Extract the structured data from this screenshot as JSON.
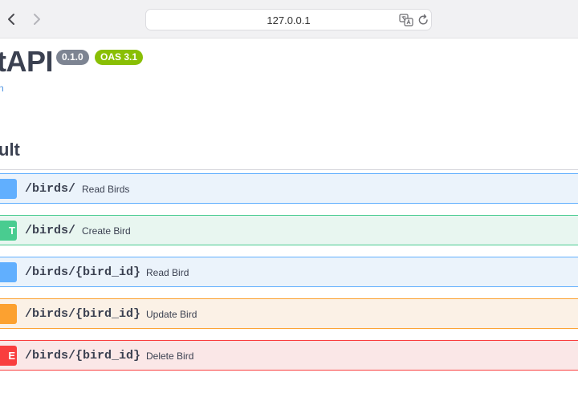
{
  "browser": {
    "url": "127.0.0.1",
    "back_icon": "chevron-left-icon",
    "forward_icon": "chevron-right-icon",
    "translate_icon": "translate-icon",
    "reload_icon": "reload-icon"
  },
  "header": {
    "title": "tAPI",
    "version_badge": "0.1.0",
    "oas_badge": "OAS 3.1",
    "spec_link": "n"
  },
  "section": {
    "title": "ult"
  },
  "operations": [
    {
      "method": "",
      "path": "/birds/",
      "summary": "Read Birds",
      "color": "#61affe"
    },
    {
      "method": "T",
      "path": "/birds/",
      "summary": "Create Bird",
      "color": "#49cc90"
    },
    {
      "method": "",
      "path": "/birds/{bird_id}",
      "summary": "Read Bird",
      "color": "#61affe"
    },
    {
      "method": "",
      "path": "/birds/{bird_id}",
      "summary": "Update Bird",
      "color": "#fca130"
    },
    {
      "method": "E",
      "path": "/birds/{bird_id}",
      "summary": "Delete Bird",
      "color": "#f93e3e"
    }
  ]
}
